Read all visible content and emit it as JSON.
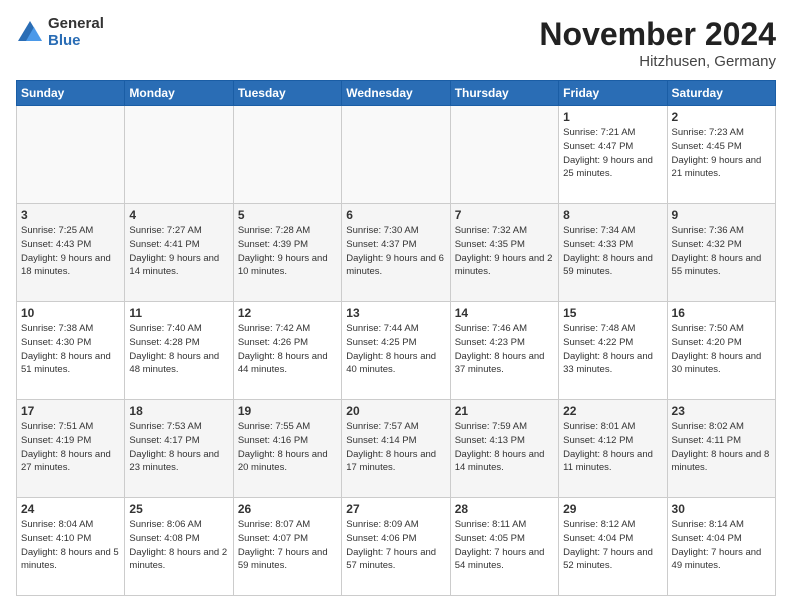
{
  "logo": {
    "general": "General",
    "blue": "Blue"
  },
  "title": "November 2024",
  "location": "Hitzhusen, Germany",
  "headers": [
    "Sunday",
    "Monday",
    "Tuesday",
    "Wednesday",
    "Thursday",
    "Friday",
    "Saturday"
  ],
  "weeks": [
    [
      {
        "day": "",
        "info": ""
      },
      {
        "day": "",
        "info": ""
      },
      {
        "day": "",
        "info": ""
      },
      {
        "day": "",
        "info": ""
      },
      {
        "day": "",
        "info": ""
      },
      {
        "day": "1",
        "info": "Sunrise: 7:21 AM\nSunset: 4:47 PM\nDaylight: 9 hours\nand 25 minutes."
      },
      {
        "day": "2",
        "info": "Sunrise: 7:23 AM\nSunset: 4:45 PM\nDaylight: 9 hours\nand 21 minutes."
      }
    ],
    [
      {
        "day": "3",
        "info": "Sunrise: 7:25 AM\nSunset: 4:43 PM\nDaylight: 9 hours\nand 18 minutes."
      },
      {
        "day": "4",
        "info": "Sunrise: 7:27 AM\nSunset: 4:41 PM\nDaylight: 9 hours\nand 14 minutes."
      },
      {
        "day": "5",
        "info": "Sunrise: 7:28 AM\nSunset: 4:39 PM\nDaylight: 9 hours\nand 10 minutes."
      },
      {
        "day": "6",
        "info": "Sunrise: 7:30 AM\nSunset: 4:37 PM\nDaylight: 9 hours\nand 6 minutes."
      },
      {
        "day": "7",
        "info": "Sunrise: 7:32 AM\nSunset: 4:35 PM\nDaylight: 9 hours\nand 2 minutes."
      },
      {
        "day": "8",
        "info": "Sunrise: 7:34 AM\nSunset: 4:33 PM\nDaylight: 8 hours\nand 59 minutes."
      },
      {
        "day": "9",
        "info": "Sunrise: 7:36 AM\nSunset: 4:32 PM\nDaylight: 8 hours\nand 55 minutes."
      }
    ],
    [
      {
        "day": "10",
        "info": "Sunrise: 7:38 AM\nSunset: 4:30 PM\nDaylight: 8 hours\nand 51 minutes."
      },
      {
        "day": "11",
        "info": "Sunrise: 7:40 AM\nSunset: 4:28 PM\nDaylight: 8 hours\nand 48 minutes."
      },
      {
        "day": "12",
        "info": "Sunrise: 7:42 AM\nSunset: 4:26 PM\nDaylight: 8 hours\nand 44 minutes."
      },
      {
        "day": "13",
        "info": "Sunrise: 7:44 AM\nSunset: 4:25 PM\nDaylight: 8 hours\nand 40 minutes."
      },
      {
        "day": "14",
        "info": "Sunrise: 7:46 AM\nSunset: 4:23 PM\nDaylight: 8 hours\nand 37 minutes."
      },
      {
        "day": "15",
        "info": "Sunrise: 7:48 AM\nSunset: 4:22 PM\nDaylight: 8 hours\nand 33 minutes."
      },
      {
        "day": "16",
        "info": "Sunrise: 7:50 AM\nSunset: 4:20 PM\nDaylight: 8 hours\nand 30 minutes."
      }
    ],
    [
      {
        "day": "17",
        "info": "Sunrise: 7:51 AM\nSunset: 4:19 PM\nDaylight: 8 hours\nand 27 minutes."
      },
      {
        "day": "18",
        "info": "Sunrise: 7:53 AM\nSunset: 4:17 PM\nDaylight: 8 hours\nand 23 minutes."
      },
      {
        "day": "19",
        "info": "Sunrise: 7:55 AM\nSunset: 4:16 PM\nDaylight: 8 hours\nand 20 minutes."
      },
      {
        "day": "20",
        "info": "Sunrise: 7:57 AM\nSunset: 4:14 PM\nDaylight: 8 hours\nand 17 minutes."
      },
      {
        "day": "21",
        "info": "Sunrise: 7:59 AM\nSunset: 4:13 PM\nDaylight: 8 hours\nand 14 minutes."
      },
      {
        "day": "22",
        "info": "Sunrise: 8:01 AM\nSunset: 4:12 PM\nDaylight: 8 hours\nand 11 minutes."
      },
      {
        "day": "23",
        "info": "Sunrise: 8:02 AM\nSunset: 4:11 PM\nDaylight: 8 hours\nand 8 minutes."
      }
    ],
    [
      {
        "day": "24",
        "info": "Sunrise: 8:04 AM\nSunset: 4:10 PM\nDaylight: 8 hours\nand 5 minutes."
      },
      {
        "day": "25",
        "info": "Sunrise: 8:06 AM\nSunset: 4:08 PM\nDaylight: 8 hours\nand 2 minutes."
      },
      {
        "day": "26",
        "info": "Sunrise: 8:07 AM\nSunset: 4:07 PM\nDaylight: 7 hours\nand 59 minutes."
      },
      {
        "day": "27",
        "info": "Sunrise: 8:09 AM\nSunset: 4:06 PM\nDaylight: 7 hours\nand 57 minutes."
      },
      {
        "day": "28",
        "info": "Sunrise: 8:11 AM\nSunset: 4:05 PM\nDaylight: 7 hours\nand 54 minutes."
      },
      {
        "day": "29",
        "info": "Sunrise: 8:12 AM\nSunset: 4:04 PM\nDaylight: 7 hours\nand 52 minutes."
      },
      {
        "day": "30",
        "info": "Sunrise: 8:14 AM\nSunset: 4:04 PM\nDaylight: 7 hours\nand 49 minutes."
      }
    ]
  ]
}
